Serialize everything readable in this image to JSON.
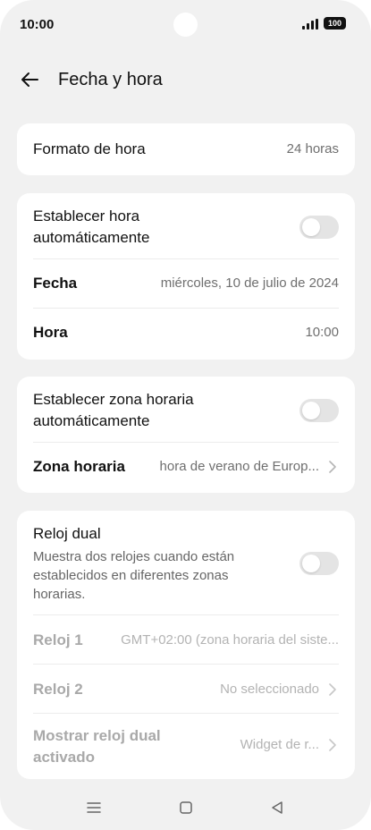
{
  "status": {
    "time": "10:00",
    "battery": "100"
  },
  "header": {
    "title": "Fecha y hora"
  },
  "format_card": {
    "label": "Formato de hora",
    "value": "24 horas"
  },
  "auto_time_card": {
    "auto_label": "Establecer hora automáticamente",
    "auto_enabled": false,
    "date_label": "Fecha",
    "date_value": "miércoles, 10 de julio de 2024",
    "time_label": "Hora",
    "time_value": "10:00"
  },
  "zone_card": {
    "auto_label": "Establecer zona horaria automáticamente",
    "auto_enabled": false,
    "zone_label": "Zona horaria",
    "zone_value": "hora de verano de Europ..."
  },
  "dual_card": {
    "title": "Reloj dual",
    "description": "Muestra dos relojes cuando están establecidos en diferentes zonas horarias.",
    "enabled": false,
    "clock1_label": "Reloj 1",
    "clock1_value": "GMT+02:00 (zona horaria del siste...",
    "clock2_label": "Reloj 2",
    "clock2_value": "No seleccionado",
    "show_label": "Mostrar reloj dual activado",
    "show_value": "Widget de r..."
  },
  "icons": {
    "back": "arrow-left-icon",
    "chevron": "chevron-right-icon",
    "nav_menu": "menu-icon",
    "nav_home": "home-square-icon",
    "nav_back": "back-triangle-icon"
  }
}
